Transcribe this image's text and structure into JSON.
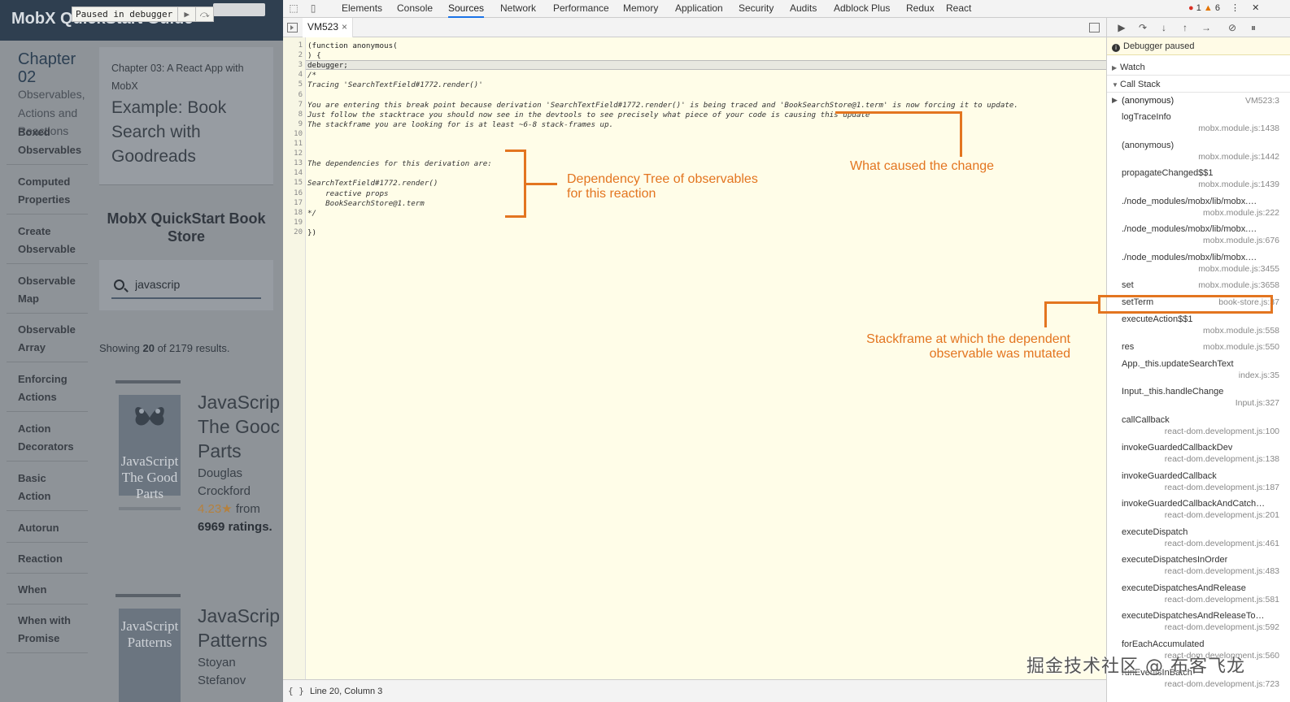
{
  "app": {
    "brand": "MobX QuickStart Guide",
    "paused_label": "Paused in debugger",
    "chapter": {
      "title": "Chapter 02",
      "subtitle": "Observables, Actions and Reactions"
    },
    "nav_items": [
      [
        "Boxed",
        "Observables"
      ],
      [
        "Computed",
        "Properties"
      ],
      [
        "Create",
        "Observable"
      ],
      [
        "Observable",
        "Map"
      ],
      [
        "Observable",
        "Array"
      ],
      [
        "Enforcing",
        "Actions"
      ],
      [
        "Action",
        "Decorators"
      ],
      [
        "Basic",
        "Action"
      ],
      [
        "Autorun"
      ],
      [
        "Reaction"
      ],
      [
        "When"
      ],
      [
        "When with",
        "Promise"
      ]
    ],
    "chapter_card": {
      "small": "Chapter 03: A React App with MobX",
      "big": "Example: Book Search with Goodreads"
    },
    "store_title": "MobX QuickStart Book Store",
    "search_value": "javascrip",
    "results": {
      "shown": "20",
      "total": "2179"
    },
    "books": [
      {
        "title_lines": [
          "JavaScrip",
          "The Gooc",
          "Parts"
        ],
        "cover_text": "JavaScript The Good Parts",
        "author_lines": [
          "Douglas",
          "Crockford"
        ],
        "rating": "4.23",
        "star": "★",
        "from": "from",
        "ratings": "6969 ratings."
      },
      {
        "title_lines": [
          "JavaScrip",
          "Patterns"
        ],
        "cover_text": "JavaScript Patterns",
        "author_lines": [
          "Stoyan",
          "Stefanov"
        ]
      }
    ]
  },
  "devtools": {
    "tabs": [
      "Elements",
      "Console",
      "Sources",
      "Network",
      "Performance",
      "Memory",
      "Application",
      "Security",
      "Audits",
      "Adblock Plus",
      "Redux",
      "React"
    ],
    "active_tab": "Sources",
    "errors": "1",
    "warnings": "6",
    "file_tab": "VM523",
    "code_lines": [
      "(function anonymous(",
      ") {",
      "debugger;",
      "/*",
      "Tracing 'SearchTextField#1772.render()'",
      "",
      "You are entering this break point because derivation 'SearchTextField#1772.render()' is being traced and 'BookSearchStore@1.term' is now forcing it to update.",
      "Just follow the stacktrace you should now see in the devtools to see precisely what piece of your code is causing this update",
      "The stackframe you are looking for is at least ~6-8 stack-frames up.",
      "",
      "",
      "",
      "The dependencies for this derivation are:",
      "",
      "SearchTextField#1772.render()",
      "    reactive props",
      "    BookSearchStore@1.term",
      "*/",
      "",
      "})"
    ],
    "status": "Line 20, Column 3",
    "right": {
      "paused": "Debugger paused",
      "watch": "Watch",
      "call_stack": "Call Stack",
      "frames": [
        {
          "fn": "(anonymous)",
          "loc": "VM523:3"
        },
        {
          "fn": "logTraceInfo",
          "loc": "mobx.module.js:1438"
        },
        {
          "fn": "(anonymous)",
          "loc": "mobx.module.js:1442"
        },
        {
          "fn": "propagateChanged$$1",
          "loc": "mobx.module.js:1439"
        },
        {
          "fn": "./node_modules/mobx/lib/mobx.…",
          "loc": "mobx.module.js:222"
        },
        {
          "fn": "./node_modules/mobx/lib/mobx.…",
          "loc": "mobx.module.js:676"
        },
        {
          "fn": "./node_modules/mobx/lib/mobx.…",
          "loc": "mobx.module.js:3455"
        },
        {
          "fn": "set",
          "loc": "mobx.module.js:3658"
        },
        {
          "fn": "setTerm",
          "loc": "book-store.js:37"
        },
        {
          "fn": "executeAction$$1",
          "loc": "mobx.module.js:558"
        },
        {
          "fn": "res",
          "loc": "mobx.module.js:550"
        },
        {
          "fn": "App._this.updateSearchText",
          "loc": "index.js:35"
        },
        {
          "fn": "Input._this.handleChange",
          "loc": "Input.js:327"
        },
        {
          "fn": "callCallback",
          "loc": "react-dom.development.js:100"
        },
        {
          "fn": "invokeGuardedCallbackDev",
          "loc": "react-dom.development.js:138"
        },
        {
          "fn": "invokeGuardedCallback",
          "loc": "react-dom.development.js:187"
        },
        {
          "fn": "invokeGuardedCallbackAndCatch…",
          "loc": "react-dom.development.js:201"
        },
        {
          "fn": "executeDispatch",
          "loc": "react-dom.development.js:461"
        },
        {
          "fn": "executeDispatchesInOrder",
          "loc": "react-dom.development.js:483"
        },
        {
          "fn": "executeDispatchesAndRelease",
          "loc": "react-dom.development.js:581"
        },
        {
          "fn": "executeDispatchesAndReleaseTo…",
          "loc": "react-dom.development.js:592"
        },
        {
          "fn": "forEachAccumulated",
          "loc": "react-dom.development.js:560"
        },
        {
          "fn": "runEventsInBatch",
          "loc": "react-dom.development.js:723"
        }
      ]
    }
  },
  "annotations": {
    "dependency_tree": [
      "Dependency Tree of observables",
      "for this reaction"
    ],
    "cause": "What caused the change",
    "stackframe": [
      "Stackframe at which the dependent",
      "observable was mutated"
    ]
  },
  "watermark": "掘金技术社区 @ 布客飞龙",
  "colors": {
    "annotation": "#e37520",
    "devtools_active_tab": "#1a73e8",
    "app_topbar": "#2f3f50"
  }
}
